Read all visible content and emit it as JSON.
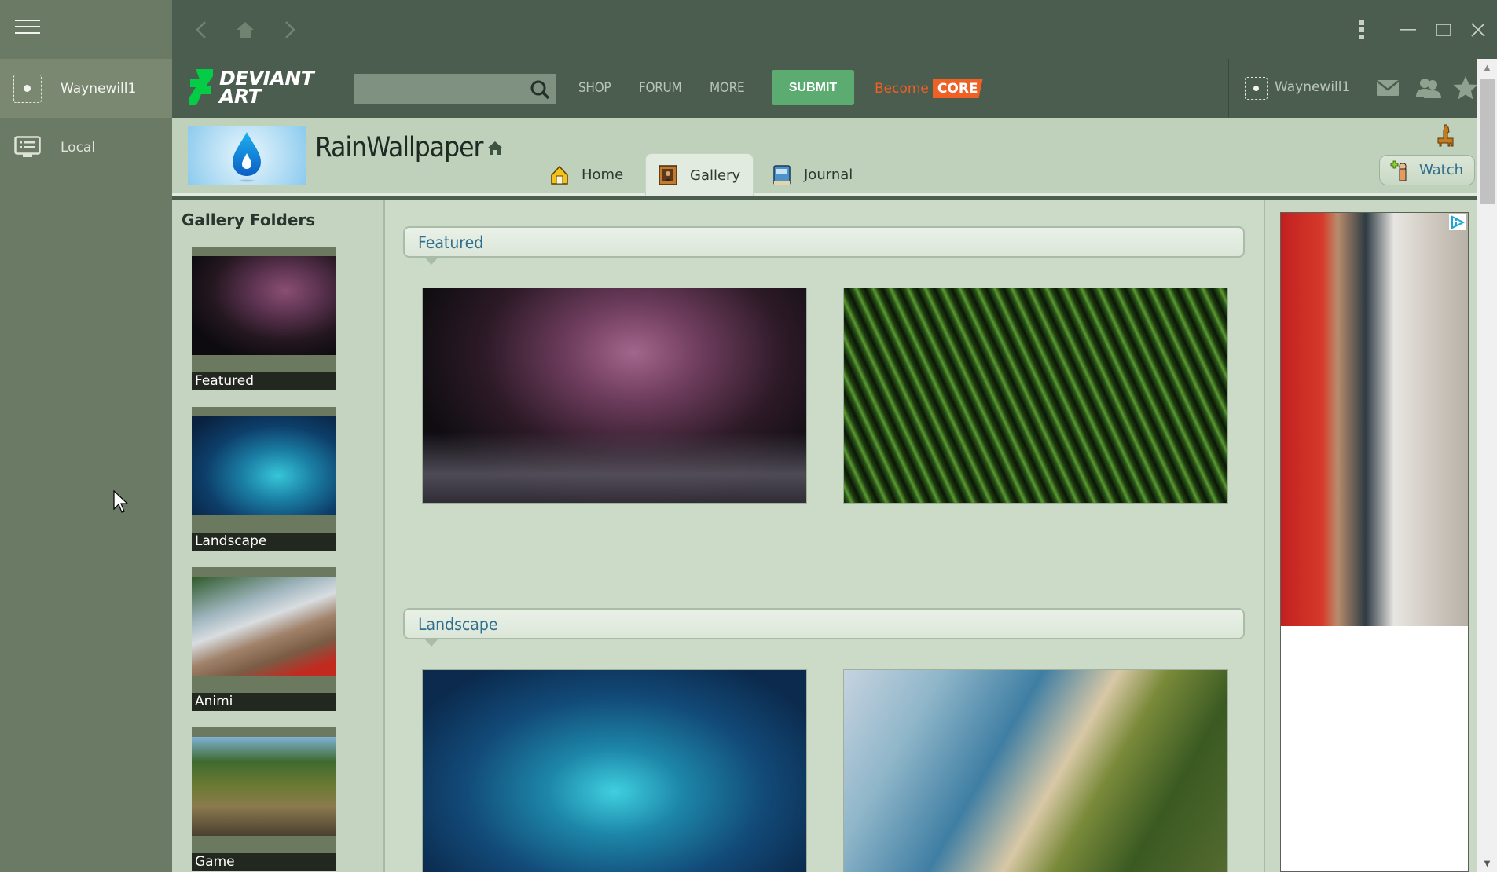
{
  "app": {
    "sidebar": {
      "menu_icon": "hamburger-icon",
      "items": [
        {
          "label": "Waynewill1",
          "icon": "avatar-placeholder-icon",
          "active": true
        },
        {
          "label": "Local",
          "icon": "monitor-list-icon",
          "active": false
        }
      ]
    },
    "nav": {
      "back_icon": "chevron-left-icon",
      "home_icon": "home-icon",
      "forward_icon": "chevron-right-icon",
      "more_icon": "kebab-menu-icon",
      "minimize_icon": "minimize-icon",
      "maximize_icon": "maximize-icon",
      "close_icon": "close-icon"
    }
  },
  "header": {
    "logo_line1": "DEVIANT",
    "logo_line2": "ART",
    "search_placeholder": "",
    "links": [
      "SHOP",
      "FORUM",
      "MORE"
    ],
    "submit_label": "SUBMIT",
    "become_label": "Become",
    "core_label": "CORE",
    "username": "Waynewill1",
    "colors": {
      "bar": "#4a5d4e",
      "submit": "#5cab71",
      "core": "#f05f23",
      "logo_green": "#05cc47"
    }
  },
  "profile": {
    "name": "RainWallpaper",
    "tabs": [
      {
        "label": "Home",
        "icon": "house-icon",
        "active": false
      },
      {
        "label": "Gallery",
        "icon": "gallery-frame-icon",
        "active": true
      },
      {
        "label": "Journal",
        "icon": "journal-book-icon",
        "active": false
      }
    ],
    "watch_label": "Watch"
  },
  "gallery": {
    "folders_title": "Gallery Folders",
    "folders": [
      {
        "label": "Featured",
        "image": "cherry-blossom-tree-night"
      },
      {
        "label": "Landscape",
        "image": "glowing-fantasy-forest"
      },
      {
        "label": "Animi",
        "image": "anime-fox-girl-shrine"
      },
      {
        "label": "Game",
        "image": "battlegrounds-soldier-rock"
      }
    ],
    "sections": [
      {
        "title": "Featured",
        "items": [
          {
            "image": "cherry-blossom-tree-night"
          },
          {
            "image": "green-grass-closeup"
          }
        ]
      },
      {
        "title": "Landscape",
        "items": [
          {
            "image": "glowing-fantasy-forest"
          },
          {
            "image": "tropical-coast-palms"
          }
        ]
      }
    ]
  },
  "ad": {
    "image": "woman-with-phone-red-booth",
    "choices_icon": "adchoices-icon"
  }
}
